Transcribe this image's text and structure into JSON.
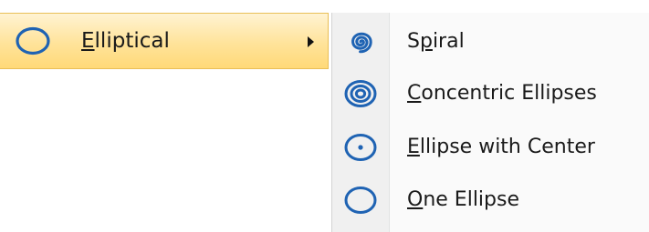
{
  "menu": {
    "parent_item": {
      "label": "Elliptical",
      "icon": "ellipse-icon",
      "has_submenu": true
    },
    "submenu": [
      {
        "label_underlined": "S",
        "label_after": "",
        "label_pre": "S",
        "label_u": "p",
        "label_post": "iral",
        "icon": "spiral-icon"
      },
      {
        "label_pre": "",
        "label_u": "C",
        "label_post": "oncentric Ellipses",
        "icon": "concentric-ellipses-icon"
      },
      {
        "label_pre": "",
        "label_u": "E",
        "label_post": "llipse with Center",
        "icon": "ellipse-with-center-icon"
      },
      {
        "label_pre": "",
        "label_u": "O",
        "label_post": "ne Ellipse",
        "icon": "one-ellipse-icon"
      }
    ]
  },
  "colors": {
    "icon_blue": "#1f63b3",
    "highlight_top": "#fff3d2",
    "highlight_bottom": "#ffd978",
    "highlight_border": "#e9bf57"
  }
}
